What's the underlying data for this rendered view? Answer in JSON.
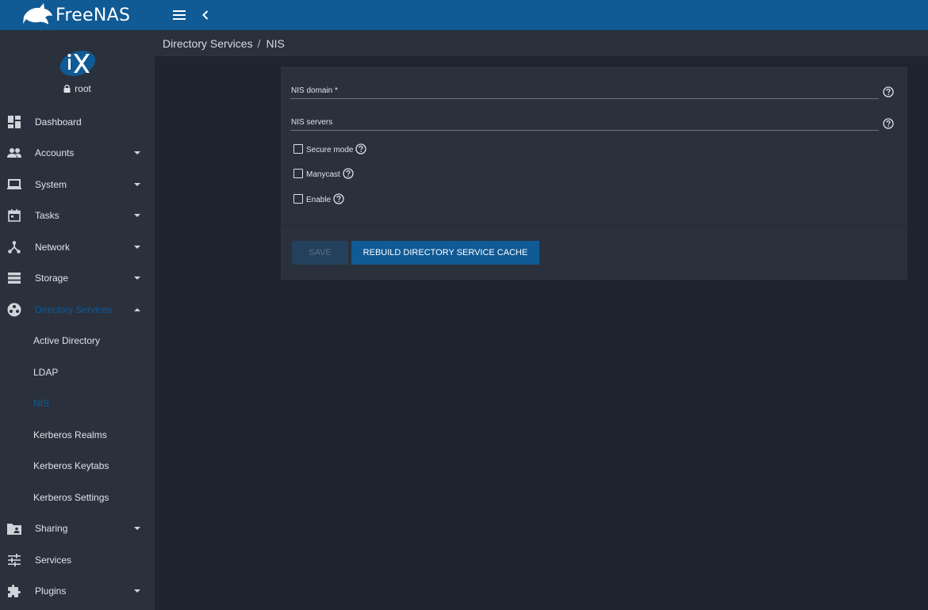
{
  "colors": {
    "topbar": "#105a95",
    "sidebar": "#2a313d",
    "main_bg": "#1e2430",
    "accent": "#105a95"
  },
  "header": {
    "brand": "FreeNAS"
  },
  "profile": {
    "username": "root"
  },
  "sidebar": {
    "items": [
      {
        "label": "Dashboard",
        "icon": "dashboard-icon"
      },
      {
        "label": "Accounts",
        "icon": "people-icon"
      },
      {
        "label": "System",
        "icon": "laptop-icon"
      },
      {
        "label": "Tasks",
        "icon": "calendar-icon"
      },
      {
        "label": "Network",
        "icon": "network-icon"
      },
      {
        "label": "Storage",
        "icon": "storage-icon"
      },
      {
        "label": "Directory Services",
        "icon": "directory-icon"
      },
      {
        "label": "Sharing",
        "icon": "folder-shared-icon"
      },
      {
        "label": "Services",
        "icon": "tune-icon"
      },
      {
        "label": "Plugins",
        "icon": "extension-icon"
      }
    ],
    "sub_items": [
      "Active Directory",
      "LDAP",
      "NIS",
      "Kerberos Realms",
      "Kerberos Keytabs",
      "Kerberos Settings"
    ]
  },
  "breadcrumb": {
    "parent": "Directory Services",
    "separator": "/",
    "current": "NIS"
  },
  "form": {
    "domain_label": "NIS domain *",
    "domain_value": "",
    "servers_label": "NIS servers",
    "servers_value": "",
    "checkboxes": [
      {
        "label": "Secure mode",
        "checked": false
      },
      {
        "label": "Manycast",
        "checked": false
      },
      {
        "label": "Enable",
        "checked": false
      }
    ],
    "save_label": "SAVE",
    "rebuild_label": "REBUILD DIRECTORY SERVICE CACHE"
  }
}
